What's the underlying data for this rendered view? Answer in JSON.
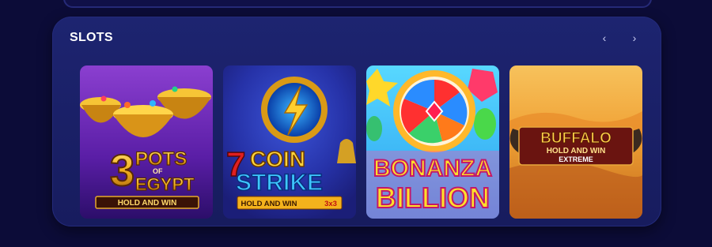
{
  "section": {
    "title": "SLOTS",
    "prev_icon": "chevron-left-icon",
    "next_icon": "chevron-right-icon"
  },
  "games": [
    {
      "line1_num": "3",
      "line1_word": "POTS",
      "line1_of": "OF",
      "line2": "EGYPT",
      "subtitle": "HOLD AND WIN"
    },
    {
      "line1_num": "7",
      "line1_word": "COIN",
      "line2": "STRIKE",
      "subtitle": "HOLD AND WIN",
      "badge": "3x3"
    },
    {
      "line1": "BONANZA",
      "line2": "BILLION"
    },
    {
      "line1": "BUFFALO",
      "line2": "HOLD AND WIN",
      "line3": "EXTREME"
    }
  ]
}
